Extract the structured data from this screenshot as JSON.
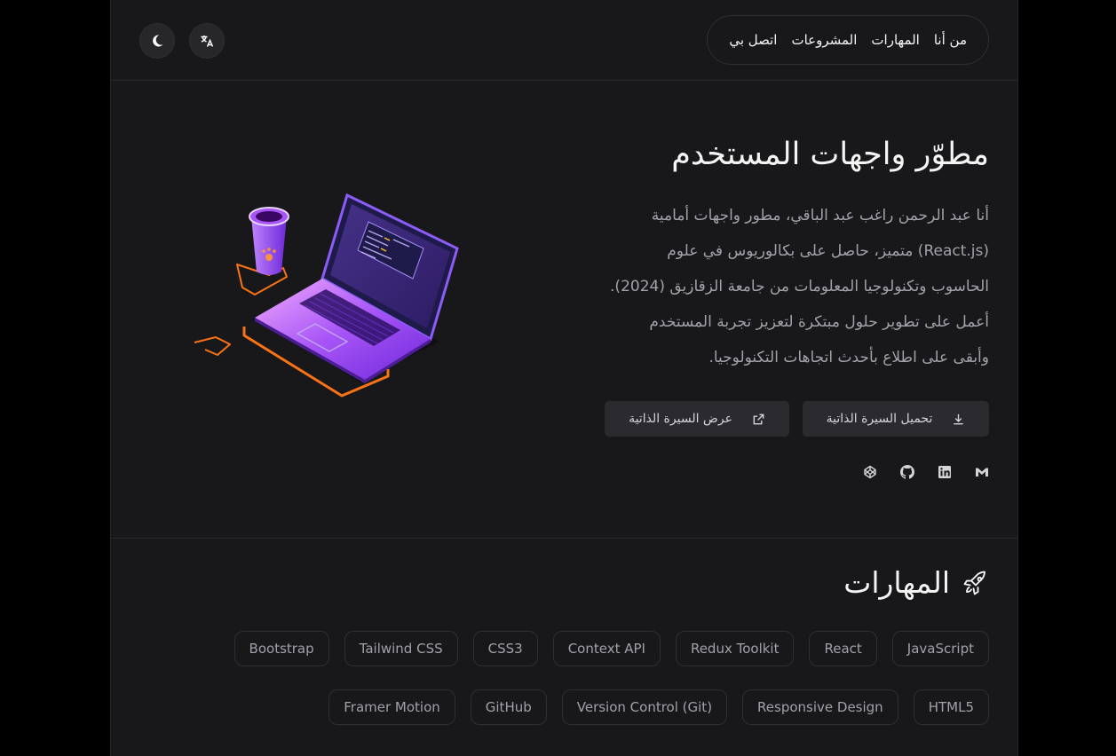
{
  "nav": {
    "items": [
      "من أنا",
      "المهارات",
      "المشروعات",
      "اتصل بي"
    ]
  },
  "header": {
    "translate_icon": "translate-icon",
    "theme_icon": "moon-icon"
  },
  "hero": {
    "title": "مطوّر واجهات المستخدم",
    "lines": [
      "أنا عبد الرحمن راغب عبد الباقي، مطور واجهات أمامية",
      "(React.js) متميز، حاصل على بكالوريوس في علوم",
      "الحاسوب وتكنولوجيا المعلومات من جامعة الزقازيق (2024).",
      "أعمل على تطوير حلول مبتكرة لتعزيز تجربة المستخدم",
      "وأبقى على اطلاع بأحدث اتجاهات التكنولوجيا."
    ],
    "download_cv": "تحميل السيرة الذاتية",
    "view_cv": "عرض السيرة الذاتية"
  },
  "socials": [
    "gmail-icon",
    "linkedin-icon",
    "github-icon",
    "codepen-icon"
  ],
  "skills": {
    "title": "المهارات",
    "items": [
      "JavaScript",
      "React",
      "Redux Toolkit",
      "Context API",
      "CSS3",
      "Tailwind CSS",
      "Bootstrap",
      "HTML5",
      "Responsive Design",
      "Version Control (Git)",
      "GitHub",
      "Framer Motion"
    ]
  },
  "colors": {
    "page_bg": "#18181b",
    "outer_bg": "#000000",
    "accent_purple": "#7c3aed",
    "accent_orange": "#f97316"
  }
}
